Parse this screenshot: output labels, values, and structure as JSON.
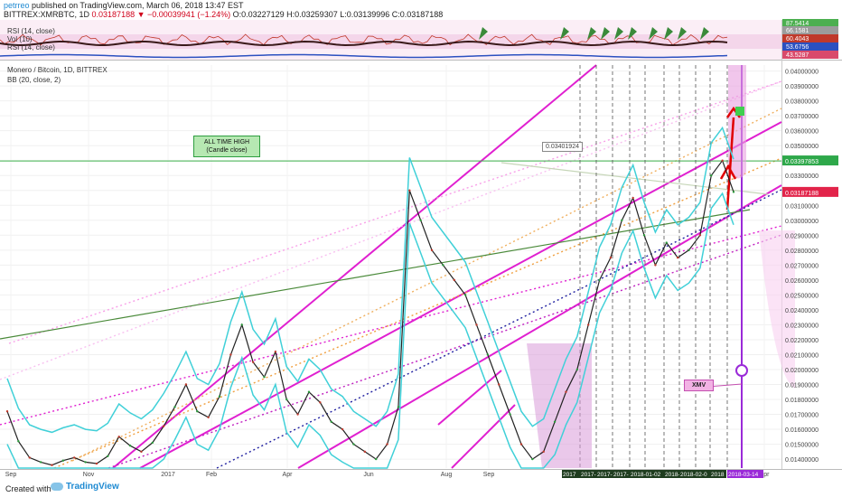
{
  "header": {
    "author": "petrreo",
    "published": "published on TradingView.com, March 06, 2018 13:47 EST",
    "symbol_line": "BITTREX:XMRBTC, 1D",
    "last": "0.03187188",
    "change": "▼ −0.00039941 (−1.24%)",
    "ohlc": "O:0.03227129 H:0.03259307 L:0.03139996 C:0.03187188"
  },
  "indicators": {
    "rsi_top_label": "RSI (14, close)",
    "vol_label": "Vol (10)",
    "rsi_label": "RSI (14, close)",
    "values": [
      "87.5414",
      "66.1581",
      "60.4043",
      "53.6756",
      "43.5287"
    ],
    "value_colors": [
      "#4caf50",
      "#9c9c9c",
      "#c0392b",
      "#2b50c0",
      "#d94a6b"
    ]
  },
  "price_panel": {
    "title": "Monero / Bitcoin, 1D, BITTREX",
    "bb_label": "BB (20, close, 2)",
    "callout_ath": [
      "ALL TIME HIGH",
      "(Candle close)"
    ],
    "price_box": "0.03401924",
    "xmv_label": "XMV"
  },
  "footer": {
    "created_with": "Created with",
    "brand": "TradingView"
  },
  "chart_data": {
    "type": "line",
    "instrument": "BITTREX:XMRBTC",
    "timeframe": "1D",
    "x_ticks": [
      "Sep",
      "Nov",
      "2017",
      "Feb",
      "Apr",
      "Jun",
      "Aug",
      "Sep",
      "Apr"
    ],
    "y_ticks": [
      "0.04000000",
      "0.03900000",
      "0.03800000",
      "0.03700000",
      "0.03600000",
      "0.03500000",
      "0.03400000",
      "0.03300000",
      "0.03200000",
      "0.03100000",
      "0.03000000",
      "0.02900000",
      "0.02800000",
      "0.02700000",
      "0.02600000",
      "0.02500000",
      "0.02400000",
      "0.02300000",
      "0.02200000",
      "0.02100000",
      "0.02000000",
      "0.01900000",
      "0.01800000",
      "0.01700000",
      "0.01600000",
      "0.01500000",
      "0.01400000"
    ],
    "ylim": [
      0.0134,
      0.0404
    ],
    "badges": [
      {
        "label": "0.03397853",
        "value": 0.03397853,
        "color": "#2ea84a"
      },
      {
        "label": "0.03187188",
        "value": 0.03187188,
        "color": "#e2244a"
      }
    ],
    "time_labels": [
      "2017",
      "2017-",
      "2017-1",
      "2017-",
      "2018-01-02",
      "2018-01",
      "2018-02-0",
      "2018",
      "2018-03-14"
    ],
    "all_time_high": 0.03397853,
    "series": [
      {
        "name": "Monero / Bitcoin",
        "color": "#222222",
        "values": [
          0.0172,
          0.0152,
          0.0141,
          0.0138,
          0.0136,
          0.0139,
          0.0141,
          0.0138,
          0.0137,
          0.0142,
          0.0155,
          0.0149,
          0.0145,
          0.0151,
          0.0162,
          0.0175,
          0.019,
          0.0172,
          0.0168,
          0.0182,
          0.021,
          0.023,
          0.0205,
          0.0195,
          0.0212,
          0.018,
          0.017,
          0.0185,
          0.0178,
          0.0165,
          0.016,
          0.015,
          0.0145,
          0.014,
          0.015,
          0.0175,
          0.032,
          0.03,
          0.028,
          0.027,
          0.026,
          0.025,
          0.023,
          0.021,
          0.019,
          0.017,
          0.015,
          0.014,
          0.0145,
          0.0165,
          0.0185,
          0.02,
          0.023,
          0.026,
          0.0275,
          0.03,
          0.0315,
          0.029,
          0.027,
          0.0285,
          0.0275,
          0.028,
          0.029,
          0.033,
          0.034,
          0.0319
        ]
      }
    ]
  }
}
